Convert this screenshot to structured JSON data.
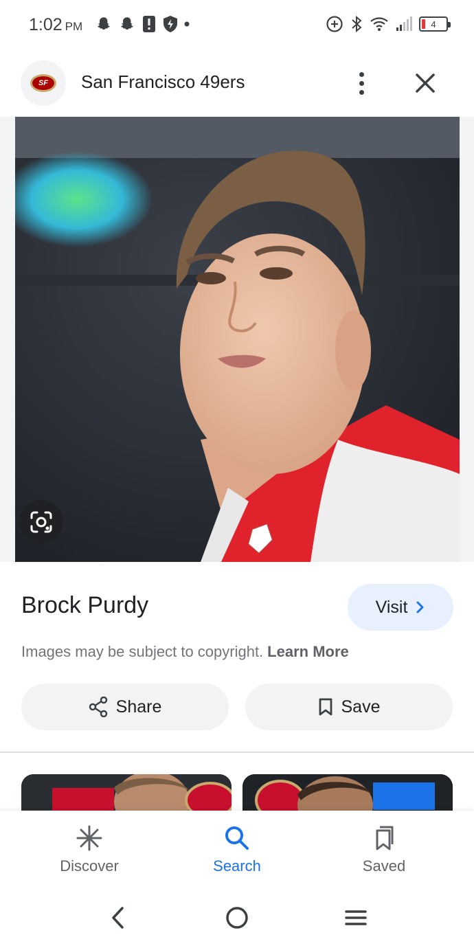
{
  "status_bar": {
    "time": "1:02",
    "ampm": "PM",
    "battery_level": "4",
    "icons_left": [
      "snapchat-icon",
      "snapchat-icon",
      "battery-alert-icon",
      "shield-icon",
      "dot-icon"
    ],
    "icons_right": [
      "data-saver-icon",
      "bluetooth-icon",
      "wifi-icon",
      "signal-icon",
      "battery-icon"
    ]
  },
  "header": {
    "title": "San Francisco 49ers",
    "logo_icon": "49ers-logo",
    "more_icon": "more-vert-icon",
    "close_icon": "close-icon"
  },
  "image": {
    "lens_icon": "google-lens-icon"
  },
  "result": {
    "title": "Brock Purdy",
    "visit_label": "Visit",
    "copyright_text": "Images may be subject to copyright.",
    "learn_more": "Learn More"
  },
  "actions": {
    "share_label": "Share",
    "save_label": "Save"
  },
  "bottom_nav": {
    "items": [
      {
        "label": "Discover",
        "icon": "asterisk-icon",
        "active": false
      },
      {
        "label": "Search",
        "icon": "search-icon",
        "active": true
      },
      {
        "label": "Saved",
        "icon": "bookmarks-icon",
        "active": false
      }
    ]
  },
  "colors": {
    "accent": "#1a73e8",
    "visit_bg": "#e8f0fe",
    "chip_bg": "#f1f3f4",
    "brand_red": "#aa0000"
  }
}
